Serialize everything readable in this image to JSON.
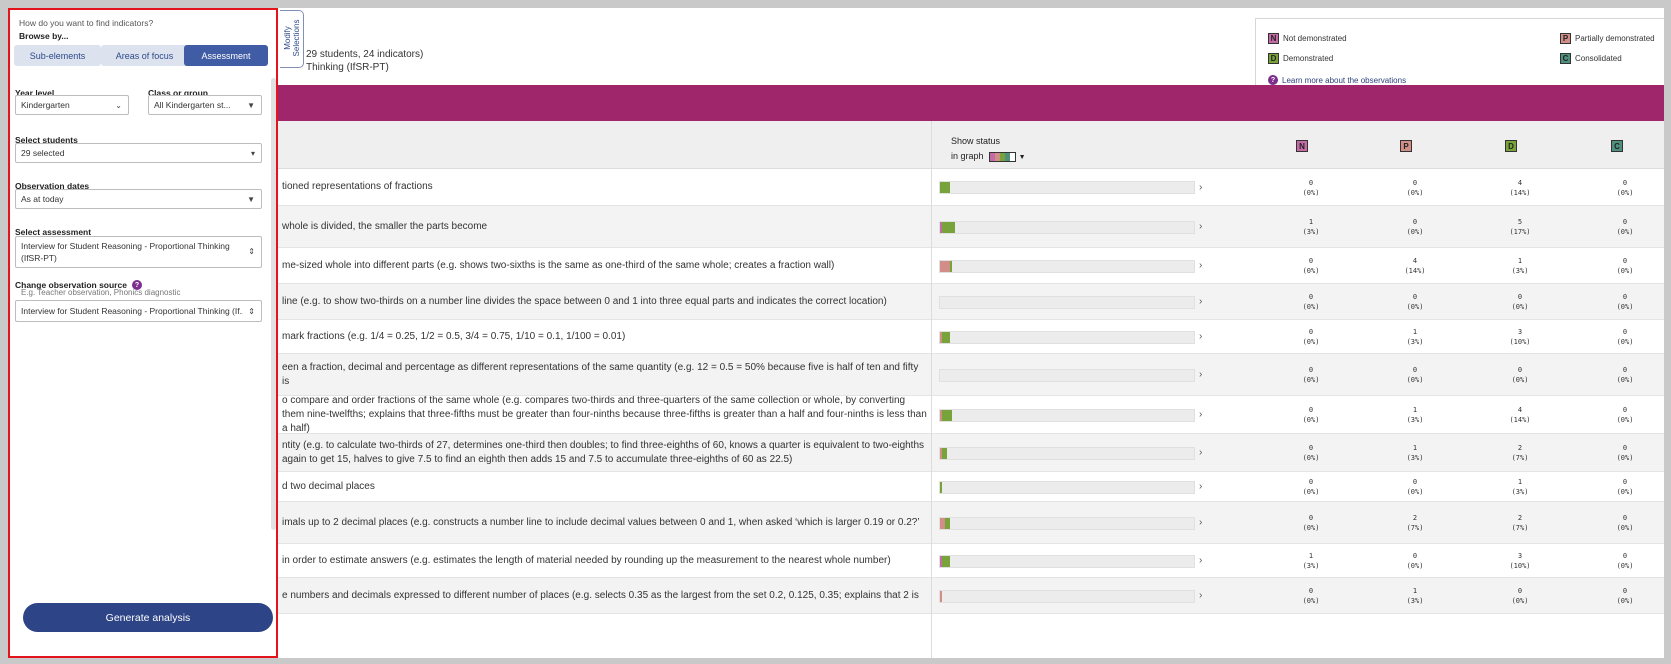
{
  "panel": {
    "question": "How do you want to find indicators?",
    "browse_label": "Browse by...",
    "tabs": [
      {
        "label": "Sub-elements",
        "active": false
      },
      {
        "label": "Areas of focus",
        "active": false
      },
      {
        "label": "Assessment",
        "active": true
      }
    ],
    "year_level": {
      "label": "Year level",
      "value": "Kindergarten"
    },
    "class_group": {
      "label": "Class or group",
      "value": "All Kindergarten st..."
    },
    "students": {
      "label": "Select students",
      "value": "29 selected"
    },
    "dates": {
      "label": "Observation dates",
      "value": "As at today"
    },
    "assessment": {
      "label": "Select assessment",
      "value": "Interview for Student Reasoning - Proportional Thinking (IfSR-PT)"
    },
    "source": {
      "label": "Change observation source",
      "hint": "E.g. Teacher observation, Phonics diagnostic",
      "value": "Interview for Student Reasoning - Proportional Thinking (If..."
    },
    "generate_label": "Generate analysis",
    "modify_label": "Modify Selections"
  },
  "summary": {
    "line1": "29 students, 24 indicators)",
    "line2": "Thinking (IfSR-PT)"
  },
  "legend": {
    "items": [
      {
        "code": "N",
        "label": "Not demonstrated",
        "color": "#c46aa6"
      },
      {
        "code": "P",
        "label": "Partially demonstrated",
        "color": "#d08e86"
      },
      {
        "code": "D",
        "label": "Demonstrated",
        "color": "#77a33a"
      },
      {
        "code": "C",
        "label": "Consolidated",
        "color": "#4e8f7e"
      }
    ],
    "learn_more": "Learn more about the observations"
  },
  "table": {
    "show_status_line1": "Show status",
    "show_status_line2": "in graph",
    "columns": [
      "N",
      "P",
      "D",
      "C"
    ],
    "rows": [
      {
        "text": "tioned representations of fractions",
        "n": "0",
        "np": "(0%)",
        "p": "0",
        "pp": "(0%)",
        "d": "4",
        "dp": "(14%)",
        "c": "0",
        "cp": "(0%)"
      },
      {
        "text": "whole is divided, the smaller the parts become",
        "n": "1",
        "np": "(3%)",
        "p": "0",
        "pp": "(0%)",
        "d": "5",
        "dp": "(17%)",
        "c": "0",
        "cp": "(0%)"
      },
      {
        "text": "me-sized whole into different parts (e.g. shows two-sixths is the same as one-third of the same whole; creates a fraction wall)",
        "n": "0",
        "np": "(0%)",
        "p": "4",
        "pp": "(14%)",
        "d": "1",
        "dp": "(3%)",
        "c": "0",
        "cp": "(0%)"
      },
      {
        "text": "line (e.g. to show two-thirds on a number line divides the space between 0 and 1 into three equal parts and indicates the correct location)",
        "n": "0",
        "np": "(0%)",
        "p": "0",
        "pp": "(0%)",
        "d": "0",
        "dp": "(0%)",
        "c": "0",
        "cp": "(0%)"
      },
      {
        "text": "mark fractions (e.g. 1/4 = 0.25, 1/2 = 0.5, 3/4 = 0.75, 1/10 = 0.1, 1/100 = 0.01)",
        "n": "0",
        "np": "(0%)",
        "p": "1",
        "pp": "(3%)",
        "d": "3",
        "dp": "(10%)",
        "c": "0",
        "cp": "(0%)"
      },
      {
        "text": "een a fraction, decimal and percentage as different representations of the same quantity (e.g. 12 = 0.5 = 50% because five is half of ten and fifty is",
        "n": "0",
        "np": "(0%)",
        "p": "0",
        "pp": "(0%)",
        "d": "0",
        "dp": "(0%)",
        "c": "0",
        "cp": "(0%)"
      },
      {
        "text": "o compare and order fractions of the same whole (e.g. compares two-thirds and three-quarters of the same collection or whole, by converting them nine-twelfths; explains that three-fifths must be greater than four-ninths because three-fifths is greater than a half and four-ninths is less than a half)",
        "n": "0",
        "np": "(0%)",
        "p": "1",
        "pp": "(3%)",
        "d": "4",
        "dp": "(14%)",
        "c": "0",
        "cp": "(0%)"
      },
      {
        "text": "ntity (e.g. to calculate two-thirds of 27, determines one-third then doubles; to find three-eighths of 60, knows a quarter is equivalent to two-eighths again to get 15, halves to give 7.5 to find an eighth then adds 15 and 7.5 to accumulate three-eighths of 60 as 22.5)",
        "n": "0",
        "np": "(0%)",
        "p": "1",
        "pp": "(3%)",
        "d": "2",
        "dp": "(7%)",
        "c": "0",
        "cp": "(0%)"
      },
      {
        "text": "d two decimal places",
        "n": "0",
        "np": "(0%)",
        "p": "0",
        "pp": "(0%)",
        "d": "1",
        "dp": "(3%)",
        "c": "0",
        "cp": "(0%)"
      },
      {
        "text": "imals up to 2 decimal places (e.g. constructs a number line to include decimal values between 0 and 1, when asked ‘which is larger 0.19 or 0.2?’",
        "n": "0",
        "np": "(0%)",
        "p": "2",
        "pp": "(7%)",
        "d": "2",
        "dp": "(7%)",
        "c": "0",
        "cp": "(0%)"
      },
      {
        "text": "in order to estimate answers (e.g. estimates the length of material needed by rounding up the measurement to the nearest whole number)",
        "n": "1",
        "np": "(3%)",
        "p": "0",
        "pp": "(0%)",
        "d": "3",
        "dp": "(10%)",
        "c": "0",
        "cp": "(0%)"
      },
      {
        "text": "e numbers and decimals expressed to different number of places (e.g. selects 0.35 as the largest from the set 0.2, 0.125, 0.35; explains that 2 is",
        "n": "0",
        "np": "(0%)",
        "p": "1",
        "pp": "(3%)",
        "d": "0",
        "dp": "(0%)",
        "c": "0",
        "cp": "(0%)"
      }
    ]
  }
}
